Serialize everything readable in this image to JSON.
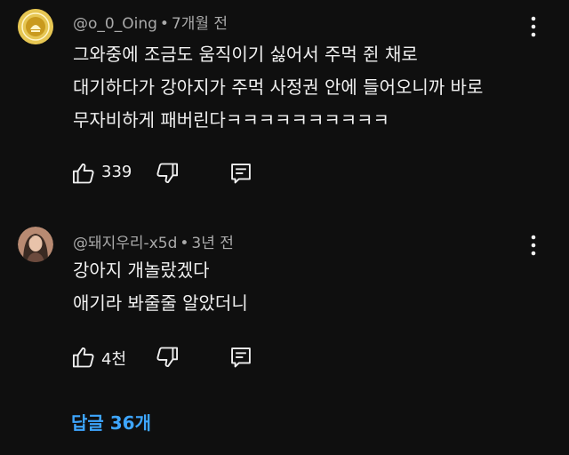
{
  "comments": [
    {
      "author": "@o_0_Oing",
      "time": "7개월 전",
      "lines": [
        "그와중에 조금도 움직이기 싫어서 주먹 쥔 채로",
        "대기하다가 강아지가 주먹 사정권 안에 들어오니까 바로",
        "무자비하게 패버린다ㅋㅋㅋㅋㅋㅋㅋㅋㅋㅋ"
      ],
      "likes": "339",
      "avatar": "gold-emblem"
    },
    {
      "author": "@돼지우리-x5d",
      "time": "3년 전",
      "lines": [
        "강아지 개놀랐겠다",
        "애기라 봐줄줄 알았더니"
      ],
      "likes": "4천",
      "avatar": "person-photo"
    }
  ],
  "meta_separator": "•",
  "replies_label": "답글 36개",
  "icons": {
    "like": "thumbs-up-icon",
    "dislike": "thumbs-down-icon",
    "reply": "reply-icon",
    "more": "more-vert-icon"
  },
  "colors": {
    "background": "#0f0f0f",
    "text": "#f1f1f1",
    "meta": "#aaaaaa",
    "link": "#3ea6ff"
  }
}
